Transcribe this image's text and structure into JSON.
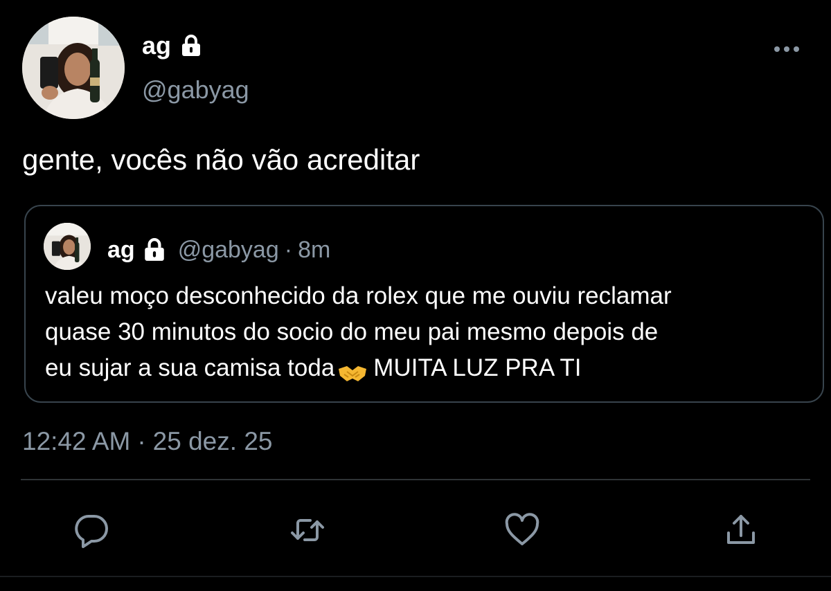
{
  "tweet": {
    "author": {
      "display_name": "ag",
      "handle": "@gabyag",
      "protected_icon": "lock-icon",
      "avatar_icon": "avatar"
    },
    "more_icon": "more-dots-icon",
    "text": "gente, vocês não vão acreditar",
    "timestamp": {
      "time": "12:42 AM",
      "separator": "·",
      "date": "25 dez. 25"
    },
    "quoted": {
      "display_name": "ag",
      "handle": "@gabyag",
      "separator": "·",
      "time": "8m",
      "text_lines": [
        "valeu moço desconhecido da rolex que me ouviu reclamar",
        "quase 30 minutos do socio do meu pai mesmo depois de",
        "eu sujar a sua camisa toda",
        "MUITA LUZ PRA TI"
      ],
      "emoji": "🤝"
    },
    "actions": [
      {
        "name": "reply",
        "icon": "reply-icon"
      },
      {
        "name": "retweet",
        "icon": "retweet-icon"
      },
      {
        "name": "like",
        "icon": "heart-icon"
      },
      {
        "name": "share",
        "icon": "share-icon"
      }
    ]
  },
  "colors": {
    "background": "#000000",
    "text": "#ffffff",
    "secondary_text": "#8b98a5",
    "border": "#38444d",
    "divider": "#2f3336"
  }
}
